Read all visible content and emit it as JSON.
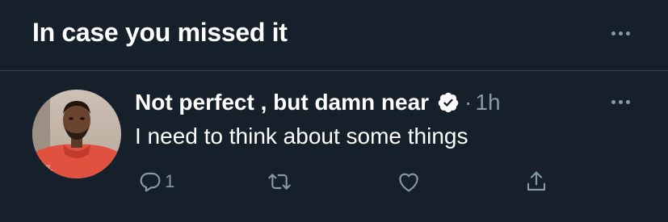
{
  "section": {
    "title": "In case you missed it"
  },
  "tweet": {
    "display_name": "Not perfect , but damn near",
    "separator": "·",
    "timestamp": "1h",
    "text": "I need to think about some things",
    "verified": true,
    "reply_count": "1",
    "avatar_icon": "user-avatar-photo"
  },
  "icons": {
    "more": "more-horizontal-icon",
    "verified": "verified-badge-icon",
    "reply": "reply-icon",
    "retweet": "retweet-icon",
    "like": "heart-icon",
    "share": "share-icon"
  },
  "colors": {
    "background": "#15202b",
    "divider": "#38444d",
    "primary_text": "#ffffff",
    "secondary_text": "#8899a6"
  }
}
